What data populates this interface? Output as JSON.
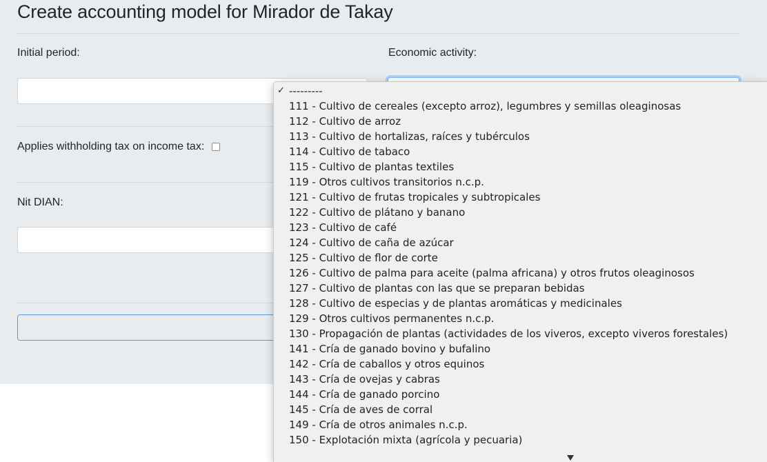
{
  "page": {
    "title": "Create accounting model for Mirador de Takay"
  },
  "form": {
    "initial_period_label": "Initial period:",
    "economic_activity_label": "Economic activity:",
    "withholding_label": "Applies withholding tax on income tax:",
    "withholding_checked": false,
    "nit_label": "Nit DIAN:"
  },
  "dropdown": {
    "selected_index": 0,
    "options": [
      "---------",
      "111 - Cultivo de cereales (excepto arroz), legumbres y semillas oleaginosas",
      "112 - Cultivo de arroz",
      "113 - Cultivo de hortalizas, raíces y tubérculos",
      "114 - Cultivo de tabaco",
      "115 - Cultivo de plantas textiles",
      "119 - Otros cultivos transitorios n.c.p.",
      "121 - Cultivo de frutas tropicales y subtropicales",
      "122 - Cultivo de plátano y banano",
      "123 - Cultivo de café",
      "124 - Cultivo de caña de azúcar",
      "125 - Cultivo de flor de corte",
      "126 - Cultivo de palma para aceite (palma africana) y otros frutos oleaginosos",
      "127 - Cultivo de plantas con las que se preparan bebidas",
      "128 - Cultivo de especias y de plantas aromáticas y medicinales",
      "129 - Otros cultivos permanentes n.c.p.",
      "130 - Propagación de plantas (actividades de los viveros, excepto viveros forestales)",
      "141 - Cría de ganado bovino y bufalino",
      "142 - Cría de caballos y otros equinos",
      "143 - Cría de ovejas y cabras",
      "144 - Cría de ganado porcino",
      "145 - Cría de aves de corral",
      "149 - Cría de otros animales n.c.p.",
      "150 - Explotación mixta (agrícola y pecuaria)"
    ]
  },
  "icons": {
    "checkmark": "checkmark-icon",
    "scroll_down": "scroll-down-arrow-icon"
  }
}
